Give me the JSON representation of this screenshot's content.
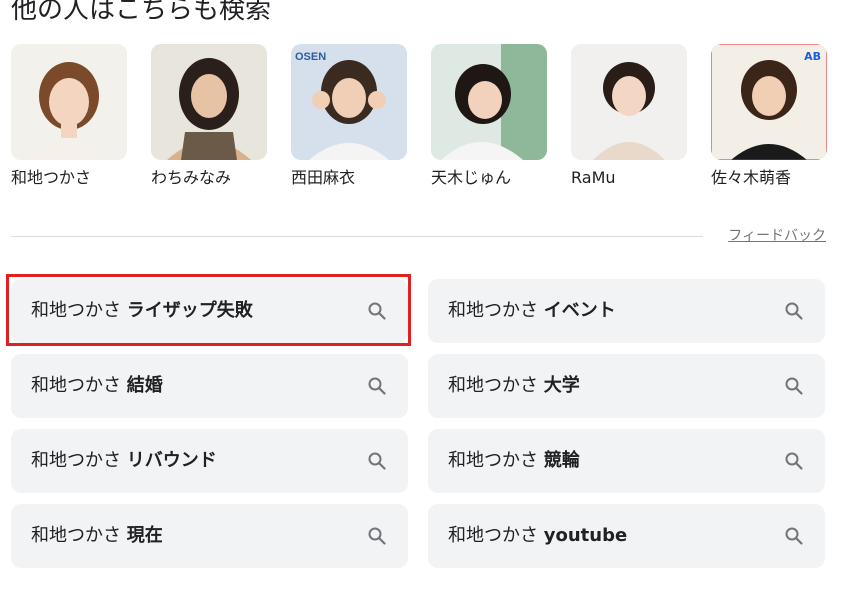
{
  "section": {
    "title": "他の人はこちらも検索"
  },
  "people": [
    {
      "name": "和地つかさ",
      "photo": "portrait-photo",
      "bg": "#f2efe9"
    },
    {
      "name": "わちみなみ",
      "photo": "portrait-photo",
      "bg": "#e9e6de"
    },
    {
      "name": "西田麻衣",
      "photo": "portrait-photo",
      "bg": "#d8e1ec"
    },
    {
      "name": "天木じゅん",
      "photo": "portrait-photo",
      "bg": "#e4ecea"
    },
    {
      "name": "RaMu",
      "photo": "portrait-photo",
      "bg": "#f1f0ee"
    },
    {
      "name": "佐々木萌香",
      "photo": "portrait-photo",
      "bg": "#f3eee6"
    }
  ],
  "feedback": {
    "label": "フィードバック"
  },
  "related_searches": [
    {
      "prefix": "和地つかさ",
      "bold": "ライザップ失敗"
    },
    {
      "prefix": "和地つかさ",
      "bold": "イベント"
    },
    {
      "prefix": "和地つかさ",
      "bold": "結婚"
    },
    {
      "prefix": "和地つかさ",
      "bold": "大学"
    },
    {
      "prefix": "和地つかさ",
      "bold": "リバウンド"
    },
    {
      "prefix": "和地つかさ",
      "bold": "競輪"
    },
    {
      "prefix": "和地つかさ",
      "bold": "現在"
    },
    {
      "prefix": "和地つかさ",
      "bold": "youtube"
    }
  ],
  "colors": {
    "chip_bg": "#f1f3f4",
    "highlight": "#e0211f",
    "text": "#202124",
    "muted": "#70757a"
  },
  "icons": {
    "chip": "search-icon"
  }
}
